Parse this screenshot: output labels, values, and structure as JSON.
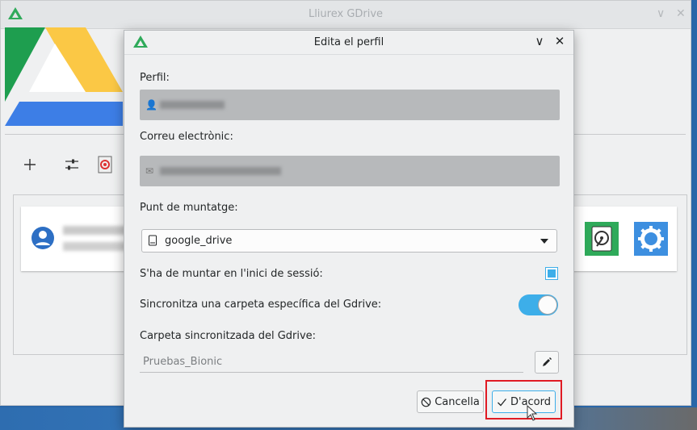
{
  "main_window": {
    "title": "Lliurex GDrive"
  },
  "dialog": {
    "title": "Edita el perfil",
    "profile_label": "Perfil:",
    "email_label": "Correu electrònic:",
    "mount_point_label": "Punt de muntatge:",
    "mount_point_value": "google_drive",
    "mount_at_login_label": "S'ha de muntar en l'inici de sessió:",
    "mount_at_login_checked": true,
    "sync_specific_label": "Sincronitza una carpeta específica del Gdrive:",
    "sync_specific_enabled": true,
    "sync_folder_label": "Carpeta sincronitzada del Gdrive:",
    "sync_folder_value": "Pruebas_Bionic",
    "cancel_label": "Cancella",
    "ok_label": "D'acord"
  },
  "colors": {
    "accent": "#3daee9",
    "highlight": "#e01b24",
    "hdd_button": "#2faa5a",
    "settings_button": "#3d8fe0"
  }
}
